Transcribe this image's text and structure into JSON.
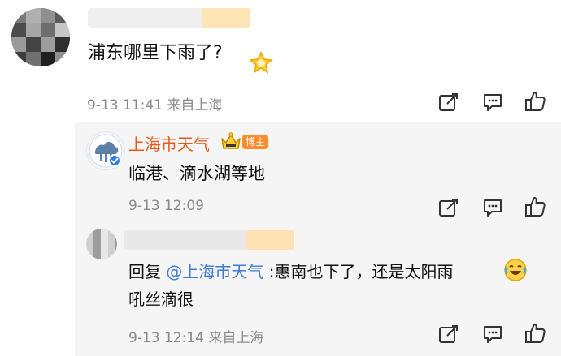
{
  "comment": {
    "text": "浦东哪里下雨了?",
    "meta": "9-13 11:41 来自上海"
  },
  "reply1": {
    "author": "上海市天气",
    "badge": "博主",
    "text": "临港、滴水湖等地",
    "meta": "9-13 12:09"
  },
  "reply2": {
    "prefix": "回复 ",
    "mention": "@上海市天气",
    "text_after_mention": ":惠南也下了，还是太阳雨",
    "text_line2": "吼丝滴很",
    "meta": "9-13 12:14 来自上海"
  },
  "icons": {
    "share": "share-icon",
    "comment": "comment-icon",
    "like": "like-icon",
    "crown": "crown-icon",
    "star_badge": "star-badge-icon",
    "laugh_cry": "laugh-cry-emoji-icon",
    "verified": "verified-icon"
  },
  "colors": {
    "meta_gray": "#8a8a8a",
    "author_orange": "#e65a1b",
    "mention_blue": "#3f7ad6",
    "badge_orange": "#ff8a2a",
    "reply_bg": "#f5f5f5"
  }
}
